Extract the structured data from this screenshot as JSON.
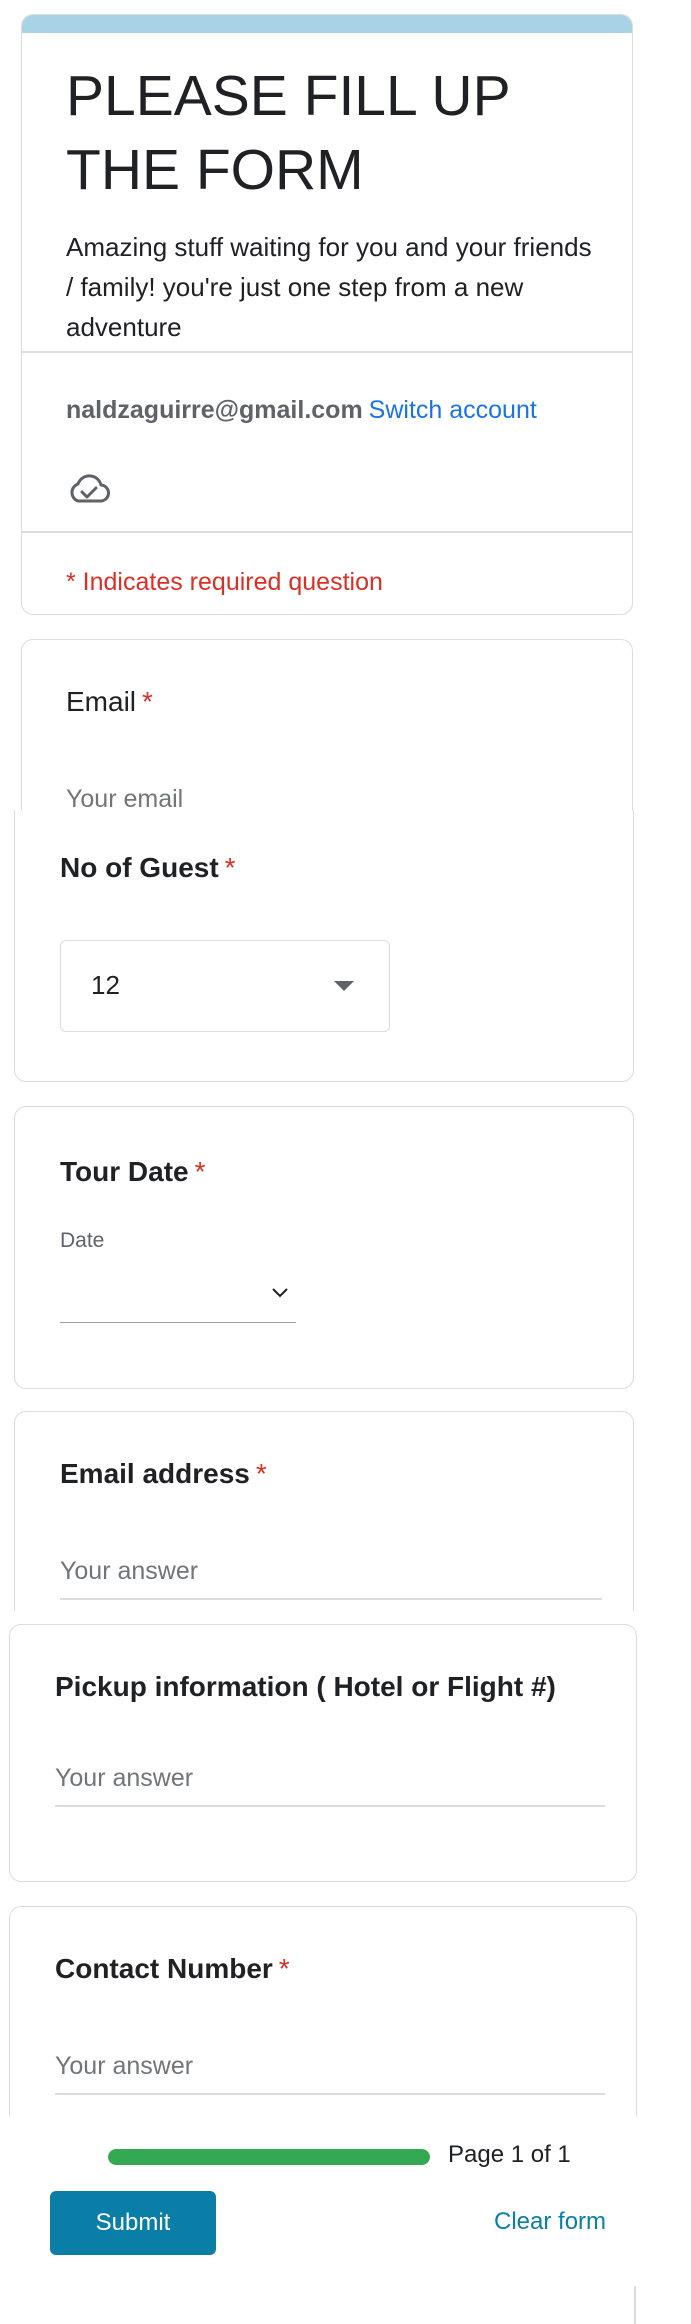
{
  "header": {
    "title": "PLEASE FILL UP THE FORM",
    "description": "Amazing stuff waiting for you and your friends / family! you're just one step from a new adventure",
    "account_email": "naldzaguirre@gmail.com",
    "switch_account_label": "Switch account",
    "cloud_icon": "cloud-check-icon",
    "required_note": "* Indicates required question"
  },
  "questions": {
    "email": {
      "title": "Email",
      "required_mark": "*",
      "placeholder": "Your email"
    },
    "guests": {
      "title": "No of Guest",
      "required_mark": "*",
      "selected": "12"
    },
    "tour_date": {
      "title": "Tour Date",
      "required_mark": "*",
      "sub_label": "Date"
    },
    "email_address": {
      "title": "Email address",
      "required_mark": "*",
      "placeholder": "Your answer"
    },
    "pickup": {
      "title": "Pickup information ( Hotel or Flight #)",
      "placeholder": "Your answer"
    },
    "contact": {
      "title": "Contact Number",
      "required_mark": "*",
      "placeholder": "Your answer"
    }
  },
  "footer": {
    "progress": 1.0,
    "page_indicator": "Page 1 of 1",
    "submit_label": "Submit",
    "clear_label": "Clear form"
  },
  "colors": {
    "accent": "#0a7ea7",
    "header_strip": "#a8d3e6",
    "required": "#d93025",
    "link": "#1a73e8",
    "progress": "#34a853"
  }
}
